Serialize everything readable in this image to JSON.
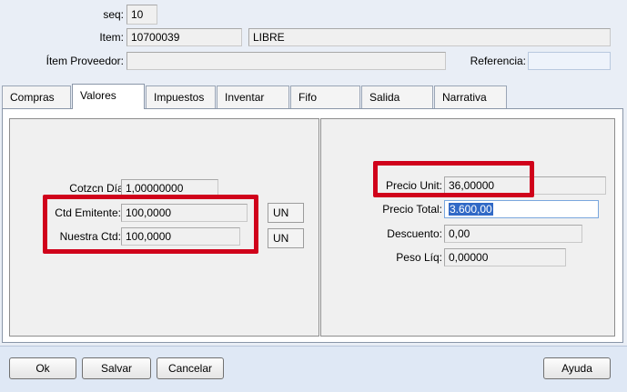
{
  "header": {
    "seq_label": "seq:",
    "seq_value": "10",
    "item_label": "Item:",
    "item_code": "10700039",
    "item_desc": "LIBRE",
    "supplier_item_label": "Ítem Proveedor:",
    "supplier_item_value": "",
    "reference_label": "Referencia:",
    "reference_value": ""
  },
  "tabs": [
    {
      "label": "Compras"
    },
    {
      "label": "Valores"
    },
    {
      "label": "Impuestos"
    },
    {
      "label": "Inventar"
    },
    {
      "label": "Fifo"
    },
    {
      "label": "Salida"
    },
    {
      "label": "Narrativa"
    }
  ],
  "left_pane": {
    "exchange_label": "Cotzcn Día:",
    "exchange_value": "1,00000000",
    "issuer_qty_label": "Ctd Emitente:",
    "issuer_qty_value": "100,0000",
    "issuer_qty_unit": "UN",
    "our_qty_label": "Nuestra Ctd:",
    "our_qty_value": "100,0000",
    "our_qty_unit": "UN"
  },
  "right_pane": {
    "unit_price_label": "Precio Unit:",
    "unit_price_value": "36,00000",
    "total_price_label": "Precio Total:",
    "total_price_value": "3.600,00",
    "discount_label": "Descuento:",
    "discount_value": "0,00",
    "net_weight_label": "Peso Líq:",
    "net_weight_value": "0,00000"
  },
  "buttons": {
    "ok": "Ok",
    "save": "Salvar",
    "cancel": "Cancelar",
    "help": "Ayuda"
  },
  "colors": {
    "highlight_box": "#d0021b",
    "selection": "#3169c6"
  }
}
